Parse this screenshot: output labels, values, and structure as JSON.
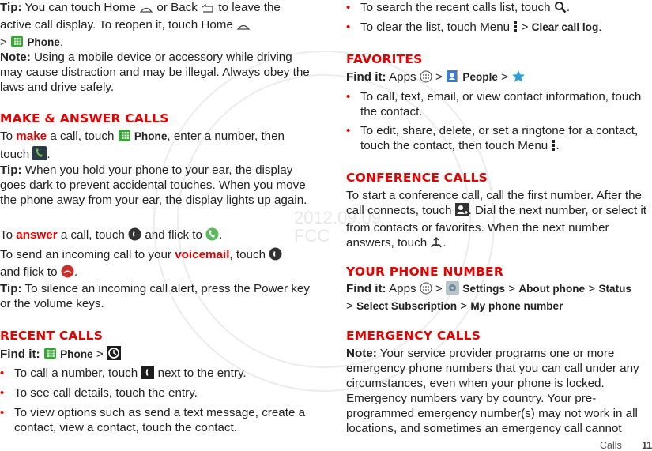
{
  "watermark": {
    "date": "2012.09.09",
    "label": "FCC"
  },
  "left": {
    "tip1": {
      "label": "Tip:",
      "t1": " You can touch Home ",
      "t2": " or Back ",
      "t3": " to leave the active call display. To reopen it, touch Home ",
      "t4": " > ",
      "phone": "Phone",
      "t5": "."
    },
    "note1": {
      "label": "Note:",
      "text": " Using a mobile device or accessory while driving may cause distraction and may be illegal. Always obey the laws and drive safely."
    },
    "make_answer": {
      "heading": "Make & Answer Calls",
      "make": {
        "t1": "To ",
        "kw": "make",
        "t2": " a call, touch ",
        "phone": "Phone",
        "t3": ", enter a number, then touch ",
        "t4": "."
      },
      "tip": {
        "label": "Tip:",
        "text": " When you hold your phone to your ear, the display goes dark to prevent accidental touches. When you move the phone away from your ear, the display lights up again."
      },
      "answer": {
        "t1": "To ",
        "kw": "answer",
        "t2": " a call, touch ",
        "t3": " and flick to ",
        "t4": "."
      },
      "voicemail": {
        "t1": "To send an incoming call to your ",
        "kw": "voicemail",
        "t2": ", touch ",
        "t3": " and flick to ",
        "t4": "."
      },
      "tip2": {
        "label": "Tip:",
        "text": " To silence an incoming call alert, press the Power key or the volume keys."
      }
    },
    "recent": {
      "heading": "Recent Calls",
      "find_label": "Find it:",
      "phone": "Phone",
      "sep": " > ",
      "bullets": [
        {
          "t1": "To call a number, touch ",
          "t2": " next to the entry."
        },
        {
          "t1": "To see call details, touch the entry."
        },
        {
          "t1": "To view options such as send a text message, create a contact, view a contact, touch the contact."
        }
      ]
    }
  },
  "right": {
    "recent_more": [
      {
        "t1": "To search the recent calls list, touch ",
        "t2": "."
      },
      {
        "t1": "To clear the list, touch Menu ",
        "t2": " > ",
        "ui": "Clear call log",
        "t3": "."
      }
    ],
    "favorites": {
      "heading": "Favorites",
      "find_label": "Find it:",
      "apps": " Apps ",
      "sep": " > ",
      "people": "People",
      "bullets": [
        {
          "t1": "To call, text, email, or view contact information, touch the contact."
        },
        {
          "t1": "To edit, share, delete, or set a ringtone for a contact, touch the contact, then touch Menu ",
          "t2": "."
        }
      ]
    },
    "conference": {
      "heading": "Conference Calls",
      "t1": "To start a conference call, call the first number. After the call connects, touch ",
      "t2": ". Dial the next number, or select it from contacts or favorites. When the next number answers, touch ",
      "t3": "."
    },
    "phone_number": {
      "heading": "Your Phone Number",
      "find_label": "Find it:",
      "apps": " Apps ",
      "sep": " > ",
      "path": [
        "Settings",
        "About phone",
        "Status",
        "Select Subscription",
        "My phone number"
      ]
    },
    "emergency": {
      "heading": "Emergency Calls",
      "label": "Note:",
      "text": " Your service provider programs one or more emergency phone numbers that you can call under any circumstances, even when your phone is locked. Emergency numbers vary by country. Your pre-programmed emergency number(s) may not work in all locations, and sometimes an emergency call cannot"
    }
  },
  "footer": {
    "section": "Calls",
    "page": "11"
  },
  "colors": {
    "accent": "#e60000",
    "text": "#222222"
  }
}
